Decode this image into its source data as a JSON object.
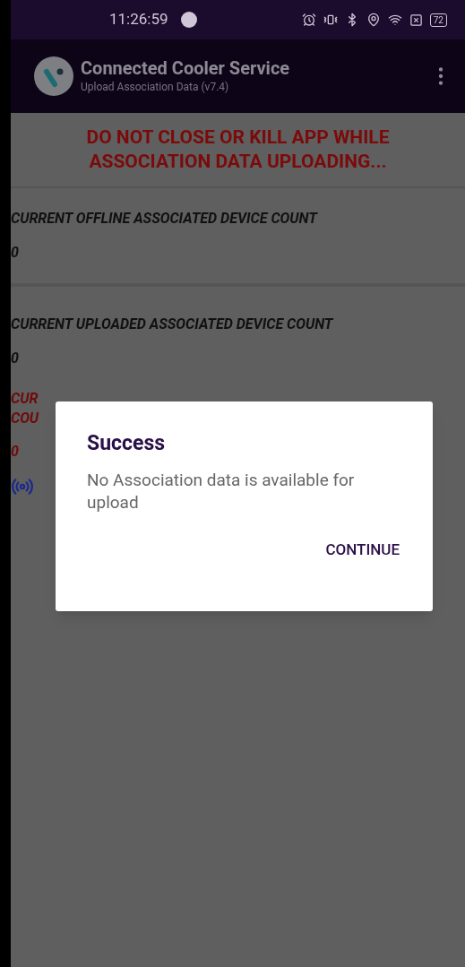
{
  "status_bar": {
    "time": "11:26:59",
    "battery": "72"
  },
  "app_bar": {
    "title": "Connected Cooler Service",
    "subtitle": "Upload Association Data (v7.4)"
  },
  "warning": "DO NOT CLOSE OR KILL APP WHILE ASSOCIATION DATA UPLOADING...",
  "counts": [
    {
      "label": "CURRENT OFFLINE ASSOCIATED DEVICE COUNT",
      "value": "0"
    },
    {
      "label": "CURRENT UPLOADED ASSOCIATED DEVICE COUNT",
      "value": "0"
    }
  ],
  "fail_count": {
    "label_lines": [
      "CUR",
      "COU"
    ],
    "value": "0"
  },
  "dialog": {
    "title": "Success",
    "message": "No Association data is available for upload",
    "button": "CONTINUE"
  }
}
